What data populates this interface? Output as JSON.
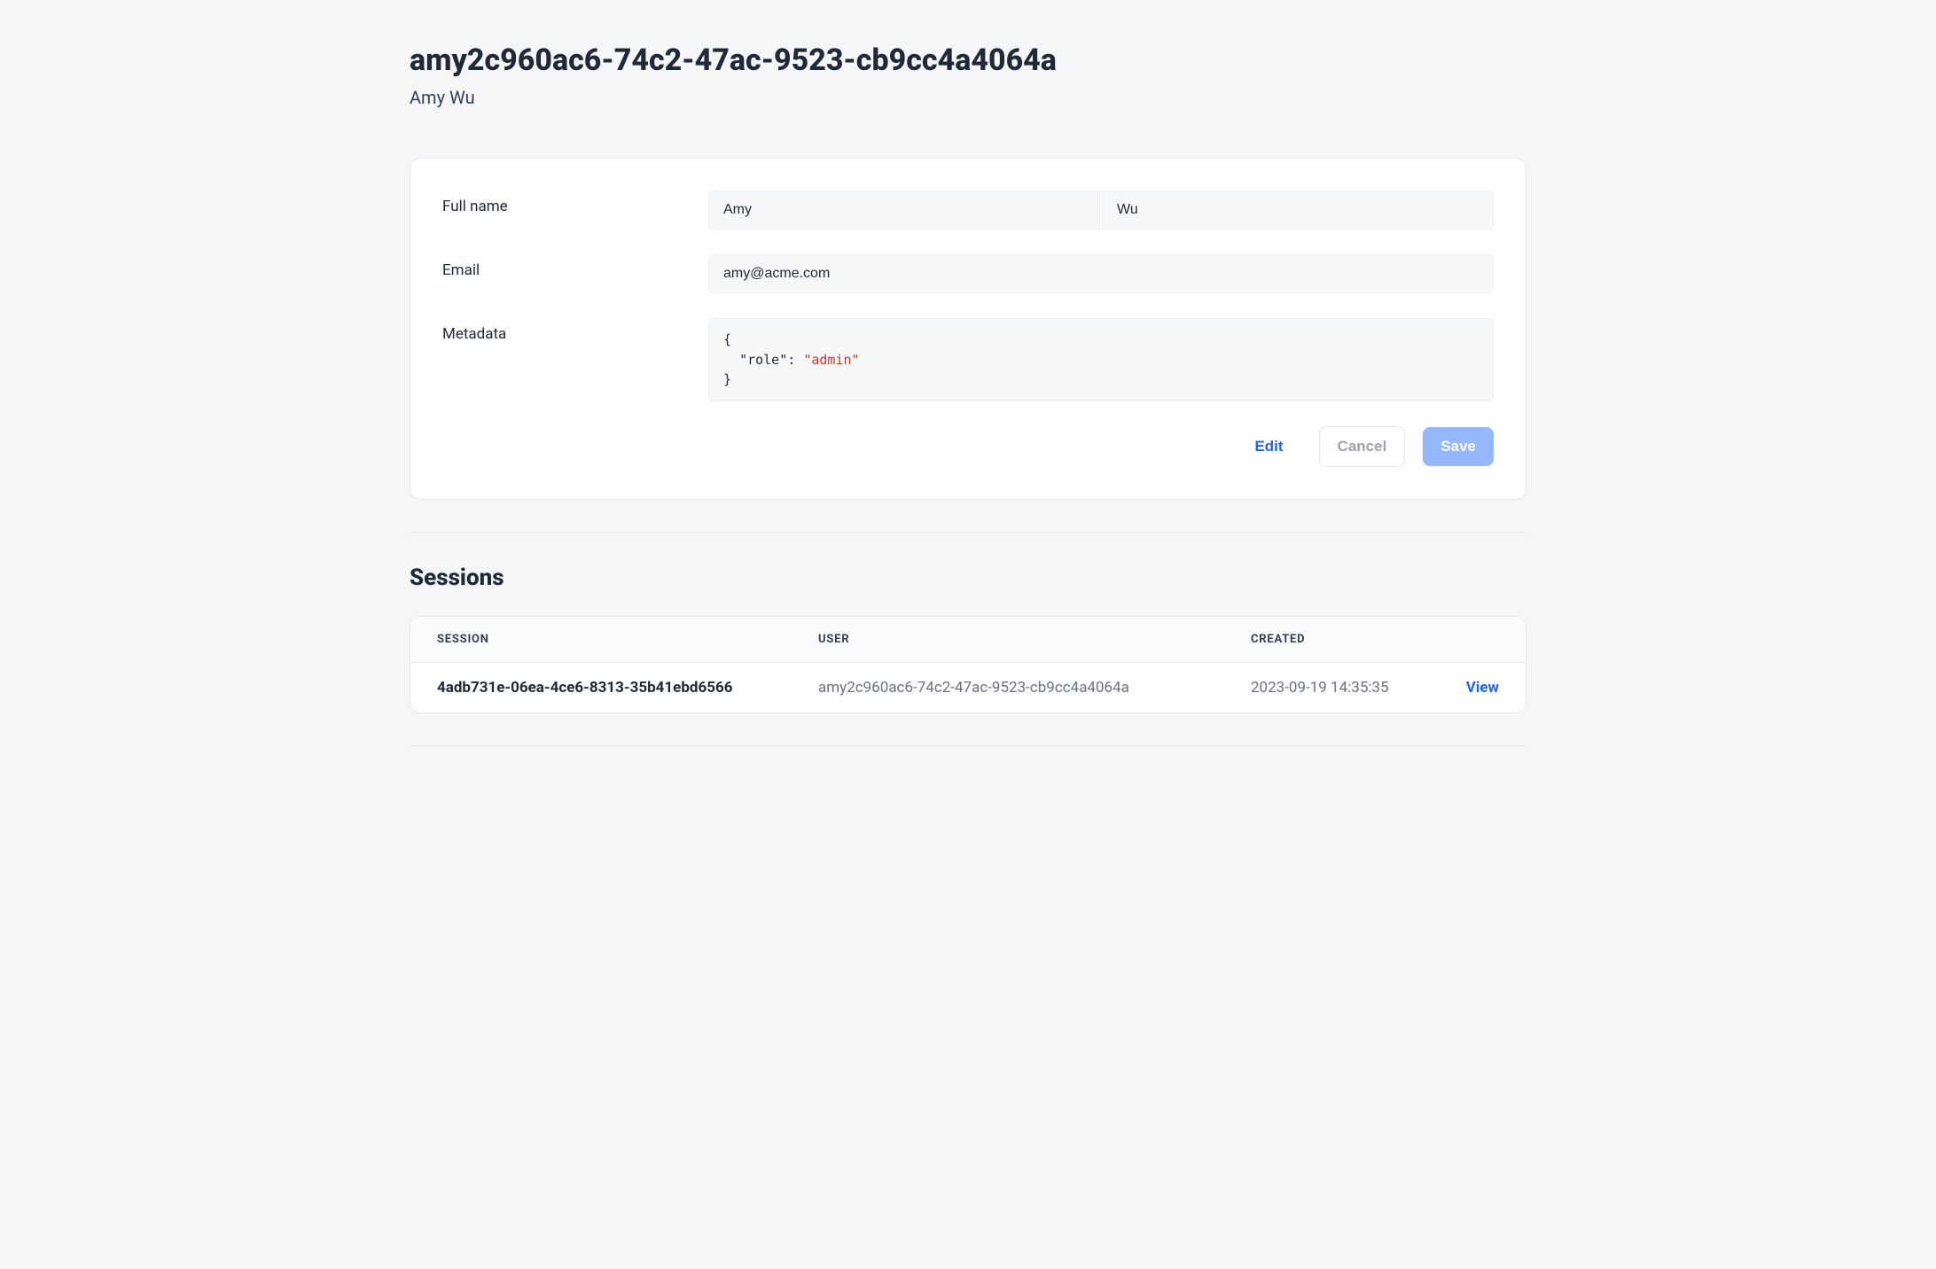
{
  "header": {
    "title": "amy2c960ac6-74c2-47ac-9523-cb9cc4a4064a",
    "subtitle": "Amy Wu"
  },
  "form": {
    "fullname_label": "Full name",
    "first_name": "Amy",
    "last_name": "Wu",
    "email_label": "Email",
    "email": "amy@acme.com",
    "metadata_label": "Metadata",
    "metadata_key": "\"role\"",
    "metadata_value": "\"admin\""
  },
  "actions": {
    "edit": "Edit",
    "cancel": "Cancel",
    "save": "Save"
  },
  "sessions": {
    "title": "Sessions",
    "columns": {
      "session": "SESSION",
      "user": "USER",
      "created": "CREATED"
    },
    "rows": [
      {
        "session": "4adb731e-06ea-4ce6-8313-35b41ebd6566",
        "user": "amy2c960ac6-74c2-47ac-9523-cb9cc4a4064a",
        "created": "2023-09-19 14:35:35",
        "view": "View"
      }
    ]
  }
}
